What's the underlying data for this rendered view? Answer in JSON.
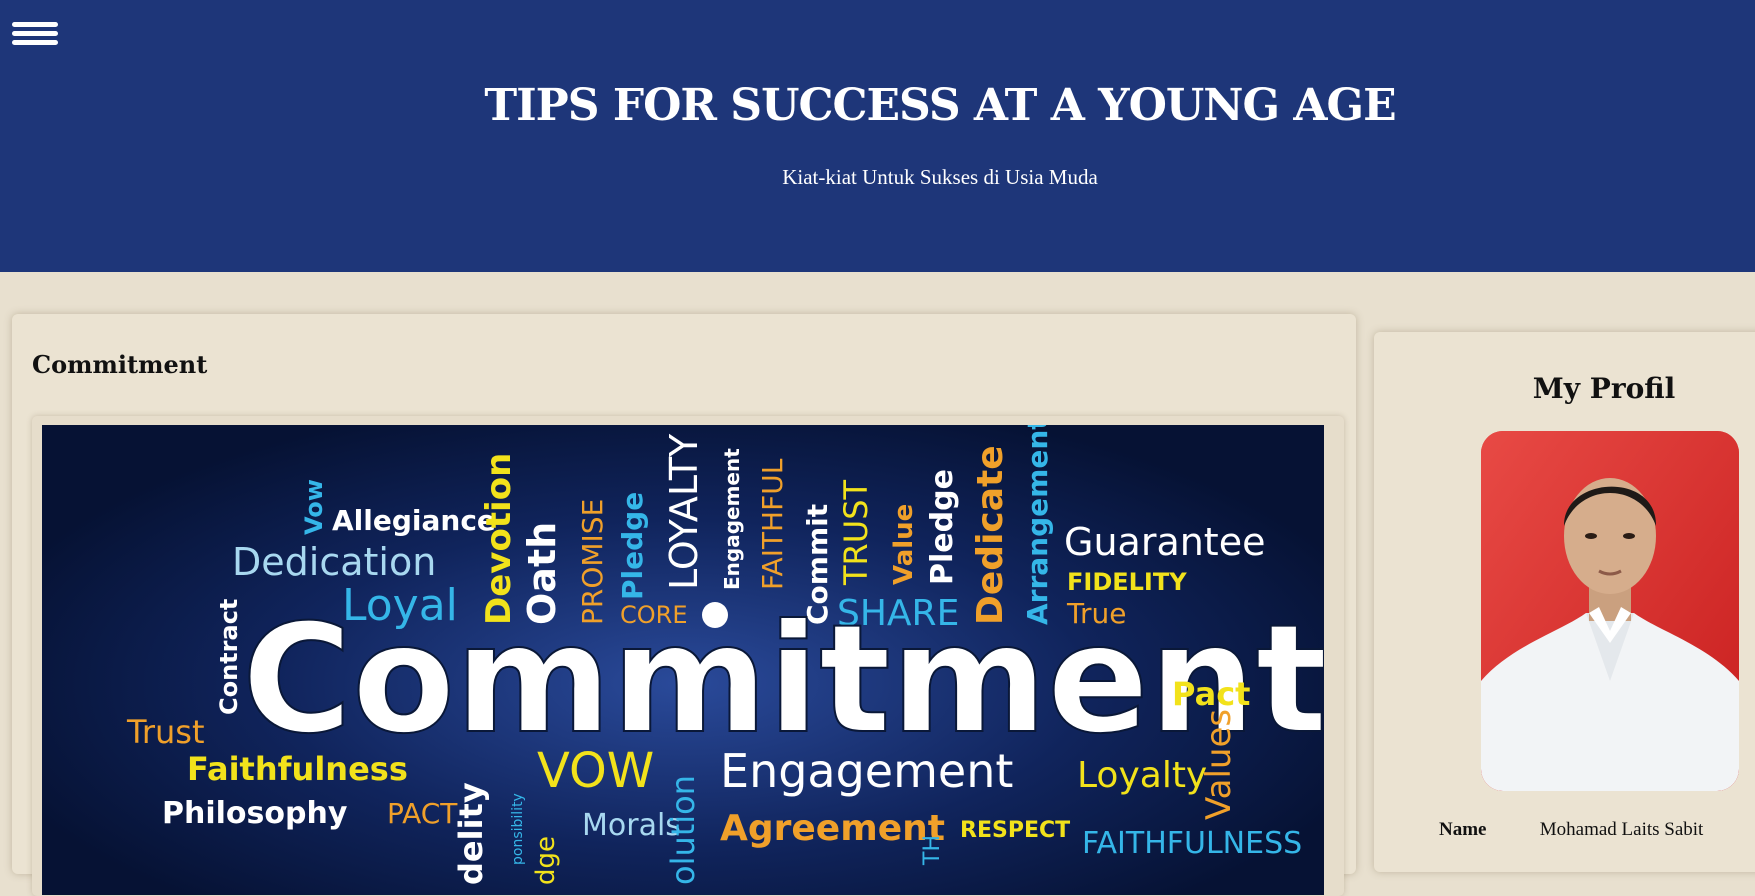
{
  "header": {
    "title": "TIPS FOR SUCCESS AT A YOUNG AGE",
    "subtitle": "Kiat-kiat Untuk Sukses di Usia Muda",
    "menu_icon": "hamburger-menu-icon",
    "background": "#1e3679"
  },
  "post": {
    "title": "Commitment",
    "image": {
      "main_word": "Commitment",
      "words": [
        "Vow",
        "Allegiance",
        "Dedication",
        "Loyal",
        "Devotion",
        "Oath",
        "PROMISE",
        "Pledge",
        "LOYALTY",
        "Engagement",
        "FAITHFUL",
        "Commit",
        "TRUST",
        "Value",
        "Pledge",
        "Dedicate",
        "Arrangement",
        "Guarantee",
        "FIDELITY",
        "True",
        "CORE",
        "SHARE",
        "Contract",
        "Trust",
        "Pact",
        "Faithfulness",
        "VOW",
        "Engagement",
        "Loyalty",
        "Values",
        "Philosophy",
        "PACT",
        "Morals",
        "Agreement",
        "RESPECT",
        "FAITHFULNESS",
        "delity",
        "dge",
        "ponsibility",
        "olution",
        "TH"
      ]
    }
  },
  "sidebar": {
    "title": "My Profil",
    "name_label": "Name",
    "name_value": "Mohamad Laits Sabit"
  },
  "colors": {
    "page_background": "#e8e0cf",
    "header_background": "#1e3679",
    "card_background": "#ebe3d2",
    "word_white": "#ffffff",
    "word_yellow": "#f2e21b",
    "word_cyan": "#35b6e8",
    "word_orange": "#f0a02a"
  }
}
